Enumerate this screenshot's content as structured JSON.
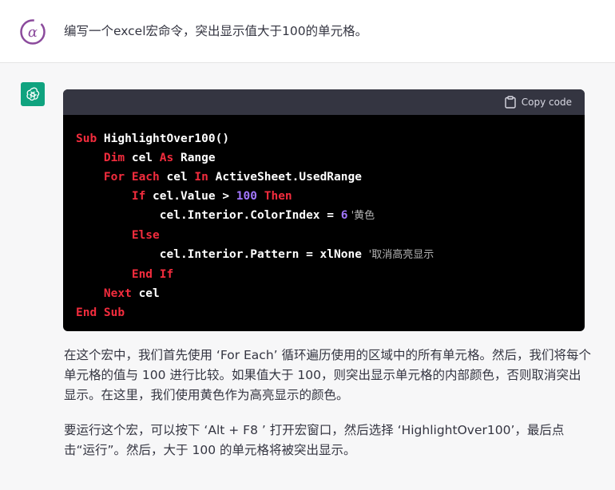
{
  "user": {
    "message": "编写一个excel宏命令，突出显示值大于100的单元格。"
  },
  "code_block": {
    "copy_label": "Copy code",
    "lines": [
      {
        "tokens": [
          {
            "t": "Sub ",
            "c": "kw"
          },
          {
            "t": "HighlightOver100()",
            "c": ""
          }
        ]
      },
      {
        "tokens": [
          {
            "t": "    Dim ",
            "c": "kw"
          },
          {
            "t": "cel ",
            "c": ""
          },
          {
            "t": "As ",
            "c": "kw"
          },
          {
            "t": "Range",
            "c": ""
          }
        ]
      },
      {
        "tokens": [
          {
            "t": "    For Each ",
            "c": "kw"
          },
          {
            "t": "cel ",
            "c": ""
          },
          {
            "t": "In ",
            "c": "kw"
          },
          {
            "t": "ActiveSheet.UsedRange",
            "c": ""
          }
        ]
      },
      {
        "tokens": [
          {
            "t": "        If ",
            "c": "kw"
          },
          {
            "t": "cel.Value > ",
            "c": ""
          },
          {
            "t": "100",
            "c": "num purple"
          },
          {
            "t": " Then",
            "c": "kw"
          }
        ]
      },
      {
        "tokens": [
          {
            "t": "            cel.Interior.ColorIndex = ",
            "c": ""
          },
          {
            "t": "6",
            "c": "num purple"
          },
          {
            "t": " '黄色",
            "c": "cm"
          }
        ]
      },
      {
        "tokens": [
          {
            "t": "        Else",
            "c": "kw"
          }
        ]
      },
      {
        "tokens": [
          {
            "t": "            cel.Interior.Pattern = xlNone ",
            "c": ""
          },
          {
            "t": "'取消高亮显示",
            "c": "cm"
          }
        ]
      },
      {
        "tokens": [
          {
            "t": "        End If",
            "c": "kw"
          }
        ]
      },
      {
        "tokens": [
          {
            "t": "    Next ",
            "c": "kw"
          },
          {
            "t": "cel",
            "c": ""
          }
        ]
      },
      {
        "tokens": [
          {
            "t": "End Sub",
            "c": "kw"
          }
        ]
      }
    ]
  },
  "assistant": {
    "paragraph1": "在这个宏中，我们首先使用 ‘For Each’ 循环遍历使用的区域中的所有单元格。然后，我们将每个单元格的值与 100 进行比较。如果值大于 100，则突出显示单元格的内部颜色，否则取消突出显示。在这里，我们使用黄色作为高亮显示的颜色。",
    "paragraph2": "要运行这个宏，可以按下 ‘Alt + F8 ’ 打开宏窗口，然后选择 ‘HighlightOver100’，最后点击“运行”。然后，大于 100 的单元格将被突出显示。"
  },
  "colors": {
    "keyword": "#f22c3d",
    "number": "#a277ff",
    "comment": "#b4b4b4",
    "gpt_avatar": "#10a37f",
    "user_avatar": "#8b4a9c"
  },
  "icons": {
    "user_avatar": "alpha-logo-icon",
    "assistant_avatar": "openai-logo-icon",
    "copy": "clipboard-icon"
  }
}
